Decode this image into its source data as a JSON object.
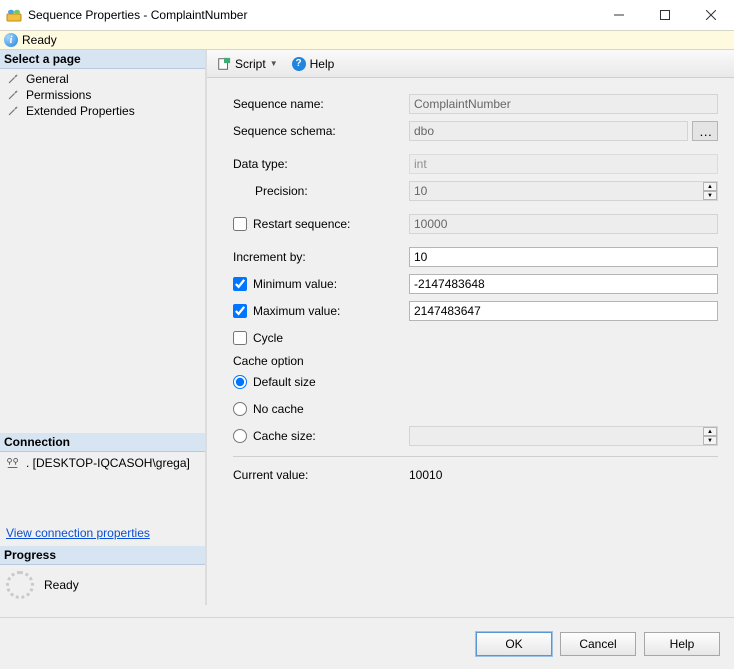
{
  "window": {
    "title": "Sequence Properties - ComplaintNumber"
  },
  "status": {
    "text": "Ready"
  },
  "sidebar": {
    "select_page": "Select a page",
    "items": [
      "General",
      "Permissions",
      "Extended Properties"
    ],
    "connection_header": "Connection",
    "connection_value": ". [DESKTOP-IQCASOH\\grega]",
    "conn_link": "View connection properties",
    "progress_header": "Progress",
    "progress_text": "Ready"
  },
  "toolbar": {
    "script": "Script",
    "help": "Help"
  },
  "form": {
    "seq_name_label": "Sequence name:",
    "seq_name_value": "ComplaintNumber",
    "seq_schema_label": "Sequence schema:",
    "seq_schema_value": "dbo",
    "data_type_label": "Data type:",
    "data_type_value": "int",
    "precision_label": "Precision:",
    "precision_value": "10",
    "restart_label": "Restart sequence:",
    "restart_value": "10000",
    "increment_label": "Increment by:",
    "increment_value": "10",
    "min_label": "Minimum value:",
    "min_value": "-2147483648",
    "max_label": "Maximum value:",
    "max_value": "2147483647",
    "cycle_label": "Cycle",
    "cache_group": "Cache option",
    "cache_default": "Default size",
    "cache_none": "No cache",
    "cache_size_label": "Cache size:",
    "cache_size_value": "",
    "current_label": "Current value:",
    "current_value": "10010"
  },
  "footer": {
    "ok": "OK",
    "cancel": "Cancel",
    "help": "Help"
  }
}
